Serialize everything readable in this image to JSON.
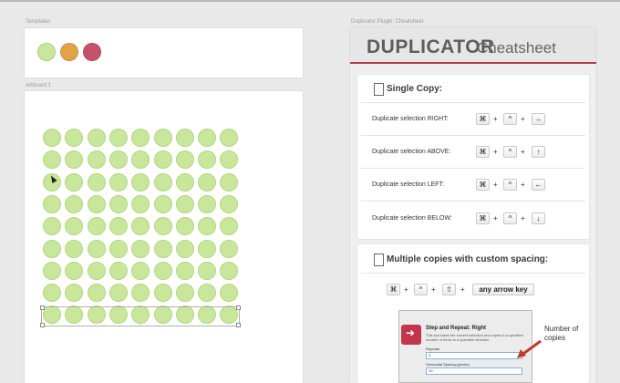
{
  "canvas": {
    "templates_label": "Templates",
    "artboard_label": "Artboard 1",
    "cheatsheet_label": "Duplicator Plugin: Cheatsheet",
    "template_swatches": [
      "#c8e79a",
      "#e2a346",
      "#c8516a"
    ],
    "dot_color": "#c8e79a",
    "grid": {
      "columns": 9,
      "rows": 9
    }
  },
  "cheatsheet": {
    "title": "DUPLICATOR",
    "subtitle": "Cheatsheet",
    "accent_color": "#b23c4d",
    "single_copy": {
      "heading": "Single Copy:",
      "rows": [
        {
          "label": "Duplicate selection RIGHT:",
          "keys": [
            "⌘",
            "^",
            "→"
          ]
        },
        {
          "label": "Duplicate selection ABOVE:",
          "keys": [
            "⌘",
            "^",
            "↑"
          ]
        },
        {
          "label": "Duplicate selection LEFT:",
          "keys": [
            "⌘",
            "^",
            "←"
          ]
        },
        {
          "label": "Duplicate selection BELOW:",
          "keys": [
            "⌘",
            "^",
            "↓"
          ]
        }
      ]
    },
    "multiple_copies": {
      "heading": "Multiple copies with custom spacing:",
      "keys": [
        "⌘",
        "^",
        "⇧",
        "any arrow key"
      ]
    },
    "dialog": {
      "title": "Step and Repeat: Right",
      "description": "This tool takes the current selection and copies it a specified number of times in a specified direction.",
      "repeats_label": "Repeats:",
      "repeats_value": "3",
      "spacing_label": "Horizontal Spacing (pixels):",
      "spacing_value": "10"
    },
    "callout": "Number of copies"
  },
  "plus_sign": "+"
}
